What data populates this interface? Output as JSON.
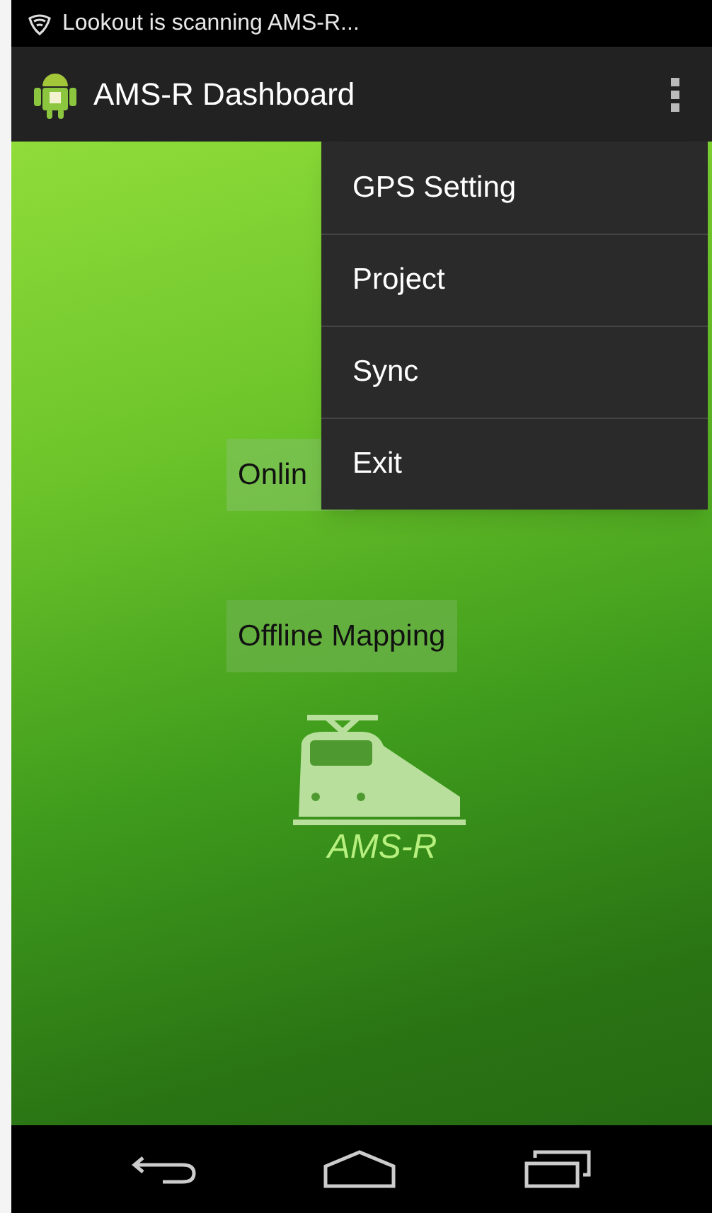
{
  "status_bar": {
    "notification": "Lookout is scanning AMS-R..."
  },
  "action_bar": {
    "title": "AMS-R Dashboard"
  },
  "buttons": [
    {
      "label": "Onlin"
    },
    {
      "label": "Offline Mapping"
    }
  ],
  "logo": {
    "caption": "AMS-R"
  },
  "menu": {
    "items": [
      {
        "label": "GPS Setting"
      },
      {
        "label": "Project"
      },
      {
        "label": "Sync"
      },
      {
        "label": "Exit"
      }
    ]
  }
}
